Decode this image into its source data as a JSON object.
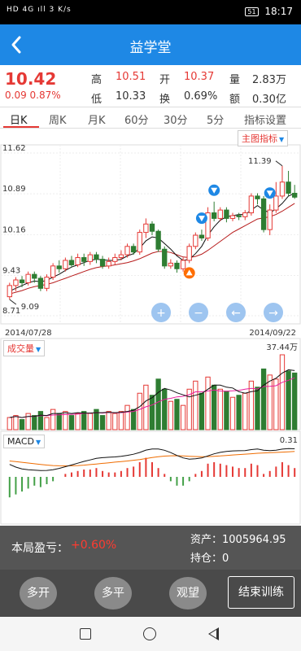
{
  "status": {
    "left": "HD 4G ıll 3 K/s",
    "battery": "51",
    "time": "18:17"
  },
  "header": {
    "title": "益学堂"
  },
  "quote": {
    "price": "10.42",
    "change": "0.09 0.87%",
    "high_label": "高",
    "high": "10.51",
    "open_label": "开",
    "open": "10.37",
    "vol_label": "量",
    "vol": "2.83万",
    "low_label": "低",
    "low": "10.33",
    "turnover_label": "换",
    "turnover": "0.69%",
    "amount_label": "额",
    "amount": "0.30亿"
  },
  "tabs": [
    "日K",
    "周K",
    "月K",
    "60分",
    "30分",
    "5分",
    "指标设置"
  ],
  "main_indicator_label": "主图指标",
  "volume_indicator_label": "成交量",
  "macd_indicator_label": "MACD",
  "account": {
    "pl_label": "本局盈亏：",
    "pl_value": "+0.60%",
    "assets": "资产：1005964.95",
    "holding": "持仓：0"
  },
  "actions": {
    "long": "多开",
    "close": "多平",
    "wait": "观望",
    "end": "结束训练"
  },
  "colors": {
    "up": "#e53935",
    "down": "#2e7d32",
    "accent": "#1e88e5"
  },
  "chart_data": [
    {
      "type": "candlestick",
      "price_ticks": [
        "11.62",
        "10.89",
        "10.16",
        "9.43",
        "8.71"
      ],
      "ylim": [
        8.71,
        11.62
      ],
      "high_label": "11.39",
      "low_label": "9.09",
      "start_date": "2014/07/28",
      "end_date": "2014/09/22",
      "candles": [
        {
          "o": 9.05,
          "c": 9.25,
          "h": 9.3,
          "l": 9.0
        },
        {
          "o": 9.25,
          "c": 9.35,
          "h": 9.4,
          "l": 9.15
        },
        {
          "o": 9.35,
          "c": 9.3,
          "h": 9.42,
          "l": 9.22
        },
        {
          "o": 9.3,
          "c": 9.45,
          "h": 9.5,
          "l": 9.25
        },
        {
          "o": 9.45,
          "c": 9.38,
          "h": 9.5,
          "l": 9.3
        },
        {
          "o": 9.38,
          "c": 9.2,
          "h": 9.42,
          "l": 9.15
        },
        {
          "o": 9.2,
          "c": 9.4,
          "h": 9.45,
          "l": 9.15
        },
        {
          "o": 9.4,
          "c": 9.6,
          "h": 9.65,
          "l": 9.35
        },
        {
          "o": 9.6,
          "c": 9.55,
          "h": 9.7,
          "l": 9.48
        },
        {
          "o": 9.55,
          "c": 9.7,
          "h": 9.75,
          "l": 9.5
        },
        {
          "o": 9.7,
          "c": 9.62,
          "h": 9.78,
          "l": 9.58
        },
        {
          "o": 9.62,
          "c": 9.75,
          "h": 9.82,
          "l": 9.58
        },
        {
          "o": 9.75,
          "c": 9.68,
          "h": 9.82,
          "l": 9.6
        },
        {
          "o": 9.68,
          "c": 9.8,
          "h": 9.85,
          "l": 9.62
        },
        {
          "o": 9.8,
          "c": 9.72,
          "h": 9.85,
          "l": 9.65
        },
        {
          "o": 9.72,
          "c": 9.6,
          "h": 9.78,
          "l": 9.55
        },
        {
          "o": 9.6,
          "c": 9.68,
          "h": 9.75,
          "l": 9.55
        },
        {
          "o": 9.68,
          "c": 9.75,
          "h": 9.82,
          "l": 9.62
        },
        {
          "o": 9.75,
          "c": 9.8,
          "h": 9.88,
          "l": 9.7
        },
        {
          "o": 9.8,
          "c": 9.95,
          "h": 10.0,
          "l": 9.75
        },
        {
          "o": 9.95,
          "c": 9.85,
          "h": 10.0,
          "l": 9.8
        },
        {
          "o": 9.85,
          "c": 10.2,
          "h": 10.25,
          "l": 9.8
        },
        {
          "o": 10.2,
          "c": 10.35,
          "h": 10.45,
          "l": 10.1
        },
        {
          "o": 10.35,
          "c": 10.22,
          "h": 10.4,
          "l": 10.15
        },
        {
          "o": 10.22,
          "c": 9.9,
          "h": 10.25,
          "l": 9.85
        },
        {
          "o": 9.9,
          "c": 9.6,
          "h": 9.95,
          "l": 9.55
        },
        {
          "o": 9.6,
          "c": 9.65,
          "h": 9.72,
          "l": 9.55
        },
        {
          "o": 9.65,
          "c": 9.55,
          "h": 9.7,
          "l": 9.48
        },
        {
          "o": 9.55,
          "c": 9.7,
          "h": 9.75,
          "l": 9.5
        },
        {
          "o": 9.7,
          "c": 9.95,
          "h": 10.0,
          "l": 9.65
        },
        {
          "o": 9.95,
          "c": 10.15,
          "h": 10.2,
          "l": 9.9
        },
        {
          "o": 10.15,
          "c": 10.1,
          "h": 10.25,
          "l": 10.05
        },
        {
          "o": 10.1,
          "c": 10.55,
          "h": 10.65,
          "l": 10.05
        },
        {
          "o": 10.55,
          "c": 10.45,
          "h": 10.75,
          "l": 10.4
        },
        {
          "o": 10.45,
          "c": 10.6,
          "h": 10.65,
          "l": 10.4
        },
        {
          "o": 10.6,
          "c": 10.45,
          "h": 10.65,
          "l": 10.38
        },
        {
          "o": 10.45,
          "c": 10.5,
          "h": 10.55,
          "l": 10.4
        },
        {
          "o": 10.5,
          "c": 10.48,
          "h": 10.55,
          "l": 10.42
        },
        {
          "o": 10.48,
          "c": 10.55,
          "h": 10.6,
          "l": 10.42
        },
        {
          "o": 10.55,
          "c": 10.85,
          "h": 10.9,
          "l": 10.5
        },
        {
          "o": 10.85,
          "c": 10.8,
          "h": 10.9,
          "l": 10.7
        },
        {
          "o": 10.8,
          "c": 10.25,
          "h": 10.85,
          "l": 10.2
        },
        {
          "o": 10.25,
          "c": 10.6,
          "h": 10.7,
          "l": 10.15
        },
        {
          "o": 10.6,
          "c": 10.85,
          "h": 11.1,
          "l": 10.55
        },
        {
          "o": 10.85,
          "c": 11.1,
          "h": 11.39,
          "l": 10.8
        },
        {
          "o": 11.1,
          "c": 10.9,
          "h": 11.3,
          "l": 10.85
        },
        {
          "o": 10.9,
          "c": 10.83,
          "h": 11.05,
          "l": 10.8
        }
      ],
      "ma_short": [
        9.15,
        9.2,
        9.25,
        9.3,
        9.33,
        9.32,
        9.34,
        9.4,
        9.45,
        9.52,
        9.58,
        9.62,
        9.66,
        9.7,
        9.72,
        9.71,
        9.7,
        9.7,
        9.72,
        9.78,
        9.82,
        9.92,
        10.05,
        10.12,
        10.1,
        10.0,
        9.9,
        9.78,
        9.7,
        9.72,
        9.82,
        9.95,
        10.15,
        10.3,
        10.42,
        10.48,
        10.5,
        10.52,
        10.52,
        10.6,
        10.68,
        10.6,
        10.55,
        10.62,
        10.72,
        10.85,
        10.9
      ],
      "ma_long": [
        9.1,
        9.13,
        9.16,
        9.2,
        9.23,
        9.25,
        9.27,
        9.3,
        9.34,
        9.38,
        9.42,
        9.46,
        9.5,
        9.54,
        9.57,
        9.59,
        9.6,
        9.62,
        9.64,
        9.66,
        9.69,
        9.73,
        9.78,
        9.83,
        9.86,
        9.86,
        9.84,
        9.8,
        9.76,
        9.75,
        9.77,
        9.81,
        9.88,
        9.96,
        10.04,
        10.12,
        10.2,
        10.26,
        10.32,
        10.38,
        10.44,
        10.46,
        10.48,
        10.52,
        10.58,
        10.65,
        10.72
      ],
      "sell_marker_candles": [
        33,
        42
      ],
      "sell_marker_low_candle": 31,
      "buy_marker_candle": 29
    },
    {
      "type": "bar",
      "title": "成交量",
      "max_label": "37.44万",
      "volumes": [
        6,
        7,
        5,
        8,
        7,
        9,
        6,
        10,
        8,
        9,
        7,
        8,
        9,
        8,
        10,
        7,
        9,
        8,
        9,
        12,
        10,
        18,
        22,
        17,
        25,
        20,
        14,
        15,
        12,
        20,
        24,
        18,
        26,
        22,
        20,
        19,
        16,
        17,
        18,
        24,
        21,
        30,
        27,
        25,
        37,
        29,
        28
      ],
      "up": [
        1,
        1,
        0,
        1,
        0,
        0,
        1,
        1,
        0,
        1,
        0,
        1,
        0,
        1,
        0,
        0,
        1,
        1,
        1,
        1,
        0,
        1,
        1,
        0,
        0,
        0,
        1,
        0,
        1,
        1,
        1,
        0,
        1,
        0,
        1,
        0,
        1,
        0,
        1,
        1,
        0,
        0,
        1,
        1,
        1,
        0,
        0
      ]
    },
    {
      "type": "bar",
      "title": "MACD",
      "max_label": "0.31",
      "macd": [
        -0.14,
        -0.12,
        -0.1,
        -0.08,
        -0.06,
        -0.07,
        -0.05,
        -0.03,
        0.0,
        0.02,
        0.03,
        0.04,
        0.05,
        0.05,
        0.06,
        0.04,
        0.03,
        0.03,
        0.04,
        0.06,
        0.07,
        0.1,
        0.13,
        0.1,
        0.06,
        0.02,
        -0.03,
        -0.06,
        -0.06,
        -0.03,
        0.02,
        0.04,
        0.09,
        0.1,
        0.09,
        0.08,
        0.07,
        0.06,
        0.06,
        0.09,
        0.08,
        0.02,
        0.04,
        0.07,
        0.1,
        0.08,
        0.06
      ]
    }
  ]
}
